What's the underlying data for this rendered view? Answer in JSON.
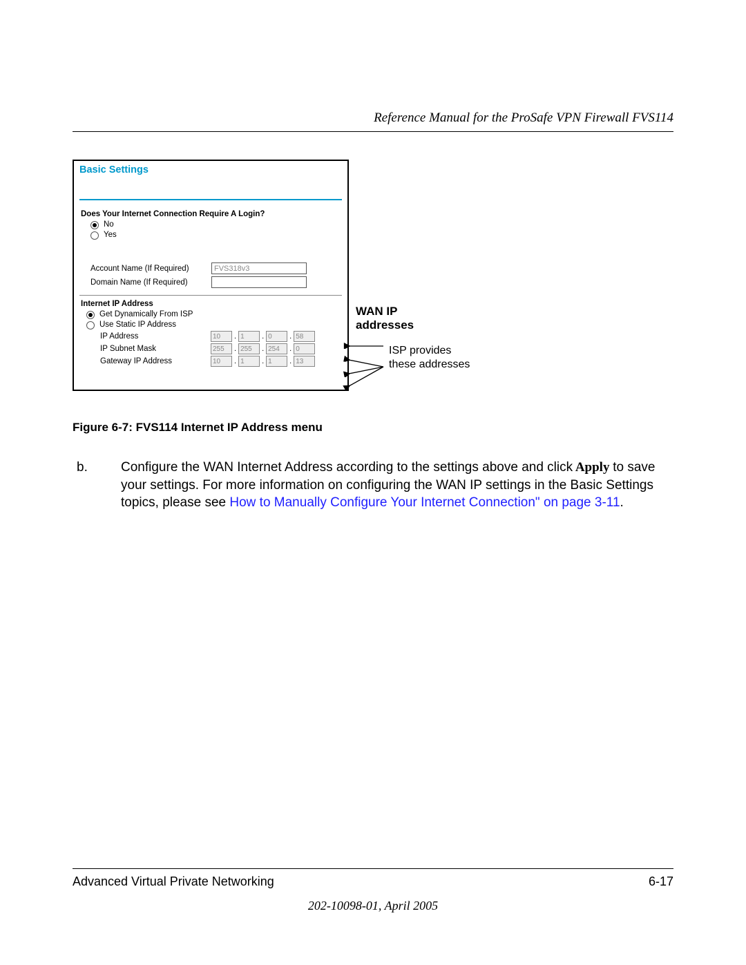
{
  "header": {
    "running_title": "Reference Manual for the ProSafe VPN Firewall FVS114"
  },
  "ui": {
    "title": "Basic Settings",
    "login_question": "Does Your Internet Connection Require A Login?",
    "no_label": "No",
    "yes_label": "Yes",
    "account_label": "Account Name  (If Required)",
    "account_value": "FVS318v3",
    "domain_label": "Domain Name  (If Required)",
    "domain_value": "",
    "iip_heading": "Internet IP Address",
    "dyn_label": "Get Dynamically From ISP",
    "static_label": "Use Static IP Address",
    "ip_addr_label": "IP Address",
    "ip_addr": [
      "10",
      "1",
      "0",
      "58"
    ],
    "subnet_label": "IP Subnet Mask",
    "subnet": [
      "255",
      "255",
      "254",
      "0"
    ],
    "gw_label": "Gateway IP Address",
    "gw": [
      "10",
      "1",
      "1",
      "13"
    ]
  },
  "annotation": {
    "title1": "WAN IP",
    "title2": "addresses",
    "line1": "ISP provides",
    "line2": "these addresses"
  },
  "caption": "Figure 6-7: FVS114 Internet IP Address menu",
  "body": {
    "letter": "b.",
    "t1": "Configure the WAN Internet Address acc",
    "t2": "ording",
    "t3": " to the settings above and click",
    "apply": " Apply ",
    "t4": "to save your settings. For more",
    "t5": " information on conf",
    "t5b": "iguring the W",
    "t5c": "AN",
    "t6": " IP settings in the Basic Settings topics, please see",
    "link1": " How to Manually Configure Your Internet Connection\" on ",
    "link2": "page 3-11",
    "period": "."
  },
  "footer": {
    "left": "Advanced Virtual Private Networking",
    "right": "6-17",
    "docnum": "202-10098-01, April 2005"
  }
}
